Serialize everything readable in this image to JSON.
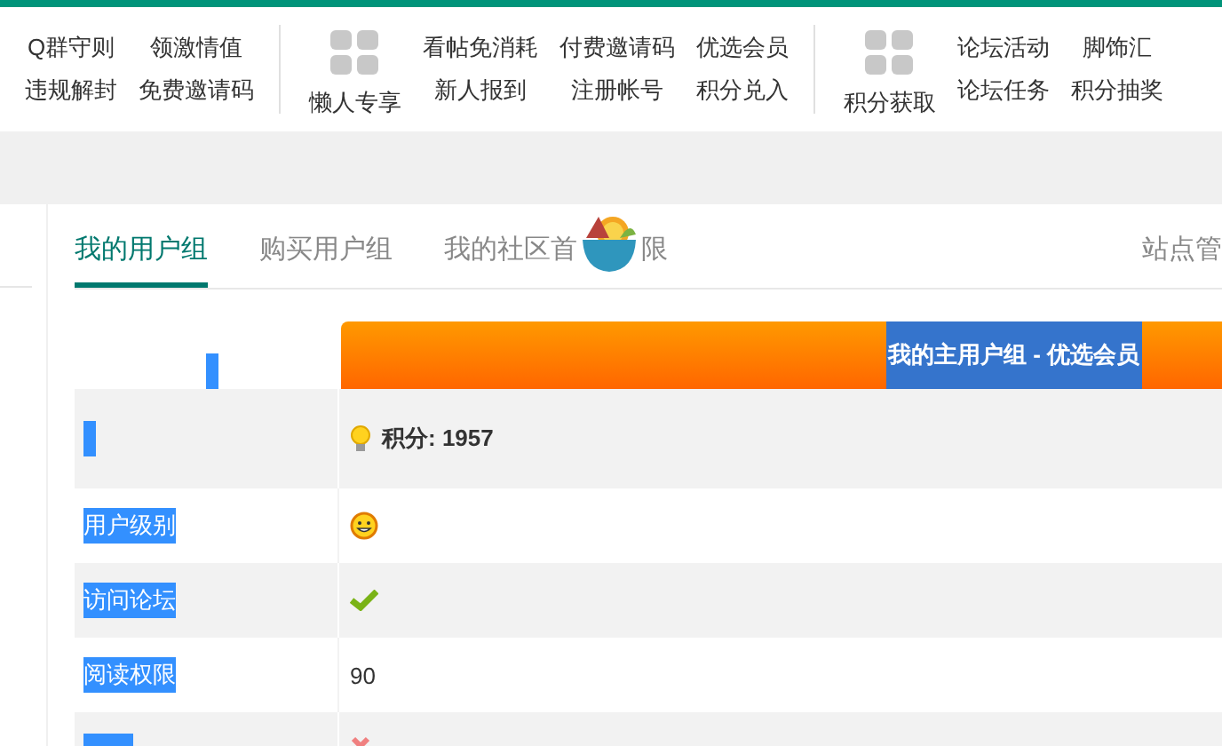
{
  "nav": {
    "groups": [
      {
        "columns": [
          [
            "Q群守则",
            "违规解封"
          ],
          [
            "领激情值",
            "免费邀请码"
          ]
        ]
      },
      {
        "icon_label": "懒人专享",
        "columns": [
          [
            "看帖免消耗",
            "新人报到"
          ],
          [
            "付费邀请码",
            "注册帐号"
          ],
          [
            "优选会员",
            "积分兑入"
          ]
        ]
      },
      {
        "icon_label": "积分获取",
        "columns": [
          [
            "论坛活动",
            "论坛任务"
          ],
          [
            "脚饰汇",
            "积分抽奖"
          ]
        ]
      }
    ]
  },
  "tabs": [
    {
      "label": "我的用户组",
      "selected": true
    },
    {
      "label": "购买用户组",
      "selected": false
    },
    {
      "label": "我的社区首",
      "label_end": "限",
      "selected": false
    }
  ],
  "admin_link": "站点管",
  "table": {
    "header_title": "我的主用户组 - 优选会员",
    "header_highlighted": true,
    "rows": [
      {
        "label": "",
        "highlighted": true,
        "kind": "points",
        "value": "积分: 1957"
      },
      {
        "label": "用户级别",
        "highlighted": true,
        "kind": "smiley",
        "value": ""
      },
      {
        "label": "访问论坛",
        "highlighted": true,
        "kind": "check",
        "value": ""
      },
      {
        "label": "阅读权限",
        "highlighted": true,
        "kind": "text",
        "value": "90"
      },
      {
        "label": "",
        "highlighted": true,
        "kind": "cross",
        "value": ""
      }
    ]
  }
}
